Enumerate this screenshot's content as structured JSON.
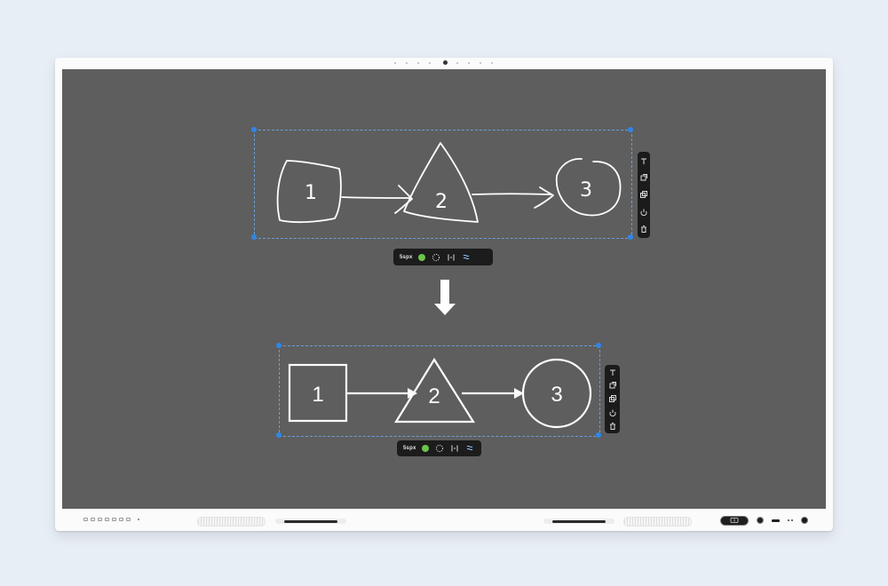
{
  "accent": "#2f86e8",
  "screen_bg": "#5e5e5e",
  "stroke_color": "#ffffff",
  "sketch": {
    "node_labels": [
      "1",
      "2",
      "3"
    ],
    "toolbar": {
      "size_label": "5spx",
      "color": "#6dc34a"
    },
    "side_tools": [
      "bring-to-front-icon",
      "copy-icon",
      "duplicate-icon",
      "recognize-icon",
      "delete-icon"
    ]
  },
  "recognized": {
    "node_labels": [
      "1",
      "2",
      "3"
    ],
    "toolbar": {
      "size_label": "5spx",
      "color": "#6dc34a"
    },
    "side_tools": [
      "bring-to-front-icon",
      "copy-icon",
      "duplicate-icon",
      "recognize-icon",
      "delete-icon"
    ]
  },
  "transition_icon": "arrow-down-icon",
  "device": {
    "ports": [
      "usb-port-icon",
      "usb-port-icon",
      "hdmi-port-icon",
      "usb-port-icon",
      "usb-port-icon",
      "usb-port-icon",
      "usb-port-icon",
      "led-icon"
    ],
    "controls": [
      "input-source-icon",
      "home-icon",
      "card-slot-icon",
      "sensor-icon",
      "power-icon"
    ]
  }
}
